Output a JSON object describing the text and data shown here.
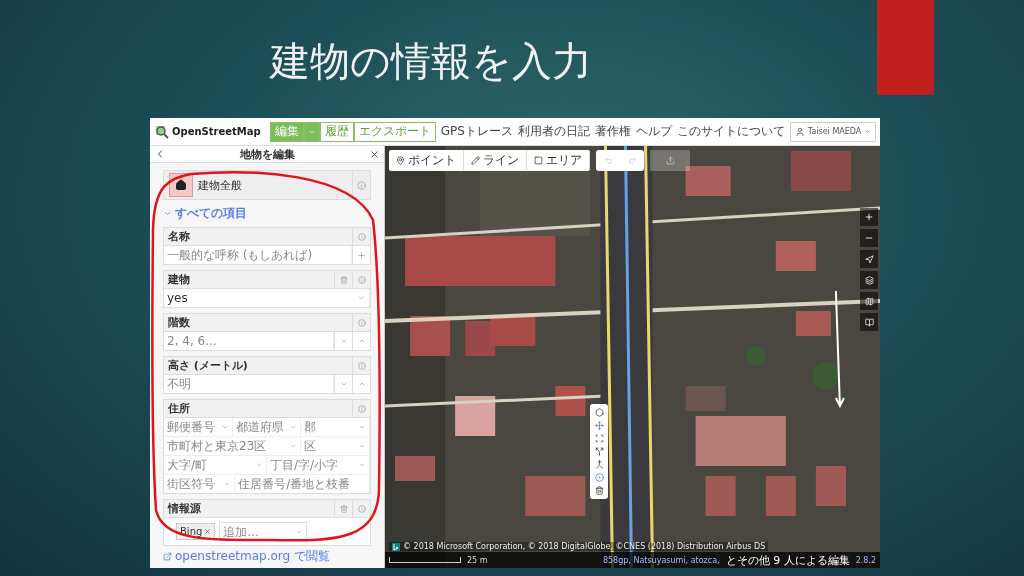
{
  "slide": {
    "title": "建物の情報を入力"
  },
  "site_header": {
    "logo": "OpenStreetMap",
    "edit_tabs": [
      {
        "label": "編集",
        "selected": true,
        "dropdown": true
      },
      {
        "label": "履歴",
        "selected": false,
        "dropdown": false
      },
      {
        "label": "エクスポート",
        "selected": false,
        "dropdown": false
      }
    ],
    "nav_links": [
      "GPSトレース",
      "利用者の日記",
      "著作権",
      "ヘルプ",
      "このサイトについて"
    ],
    "user": "Taisei MAEDA"
  },
  "sidebar": {
    "title": "地物を編集",
    "preset": {
      "name": "建物全般"
    },
    "section": {
      "label": "すべての項目",
      "expanded": true
    },
    "fields": [
      {
        "label": "名称",
        "kind": "text",
        "placeholder": "一般的な呼称 (もしあれば)",
        "deletable": false
      },
      {
        "label": "建物",
        "kind": "combo",
        "value": "yes",
        "deletable": true
      },
      {
        "label": "階数",
        "kind": "number",
        "placeholder": "2, 4, 6...",
        "deletable": false
      },
      {
        "label": "高さ (メートル)",
        "kind": "number",
        "placeholder": "不明",
        "deletable": false
      },
      {
        "label": "住所",
        "kind": "address",
        "deletable": false,
        "rows": [
          [
            {
              "placeholder": "郵便番号",
              "dropdown": true
            },
            {
              "placeholder": "都道府県",
              "dropdown": true
            },
            {
              "placeholder": "郡",
              "dropdown": true
            }
          ],
          [
            {
              "placeholder": "市町村と東京23区",
              "dropdown": true
            },
            {
              "placeholder": "区",
              "dropdown": true
            }
          ],
          [
            {
              "placeholder": "大字/町",
              "dropdown": true
            },
            {
              "placeholder": "丁目/字/小字",
              "dropdown": true
            }
          ],
          [
            {
              "placeholder": "街区符号",
              "dropdown": true
            },
            {
              "placeholder": "住居番号/番地と枝番",
              "dropdown": false
            }
          ]
        ]
      },
      {
        "label": "情報源",
        "kind": "source",
        "deletable": true,
        "tags": [
          "Bing"
        ],
        "placeholder": "追加..."
      }
    ],
    "footer_link": "openstreetmap.org で閲覧"
  },
  "map": {
    "modes": [
      {
        "label": "ポイント",
        "kind": "point"
      },
      {
        "label": "ライン",
        "kind": "line"
      },
      {
        "label": "エリア",
        "kind": "area"
      }
    ],
    "attribution": "© 2018 Microsoft Corporation, © 2018 DigitalGlobe, ©CNES (2018) Distribution Airbus DS",
    "scale": "25 m",
    "credits": {
      "names": "858gp, Natsuyasumi, atozca, ",
      "others": "とその他 9 人による編集"
    },
    "version": "2.8.2"
  }
}
